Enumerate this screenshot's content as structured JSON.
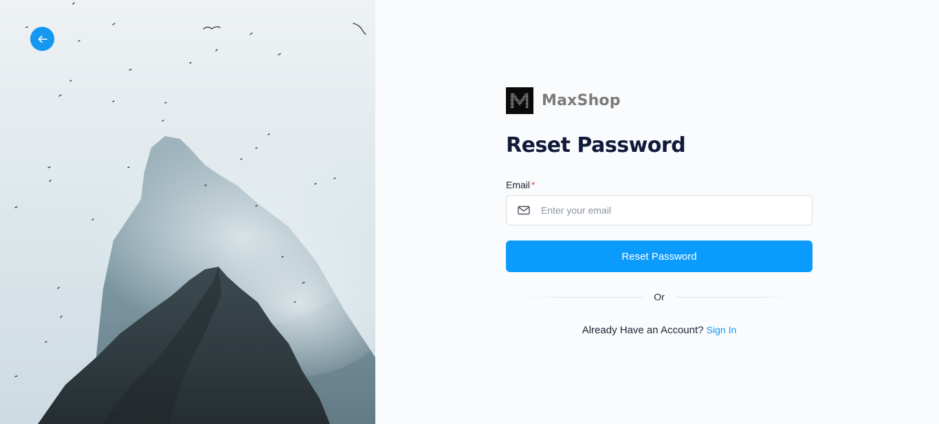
{
  "brand": {
    "name": "MaxShop",
    "logo_icon": "maxshop-logo-icon"
  },
  "hero": {
    "back_icon": "arrow-left-icon",
    "image": "misty-mountain-peak-with-birds"
  },
  "form": {
    "title": "Reset Password",
    "email": {
      "label": "Email",
      "required_mark": "*",
      "placeholder": "Enter your email",
      "value": "",
      "icon": "mail-icon"
    },
    "submit_label": "Reset Password",
    "divider_text": "Or",
    "signin_prompt": "Already Have an Account?",
    "signin_link": "Sign In"
  },
  "colors": {
    "accent": "#0b9bfd",
    "back_button": "#1497f0",
    "title": "#111a3a",
    "required": "#e5484d"
  }
}
